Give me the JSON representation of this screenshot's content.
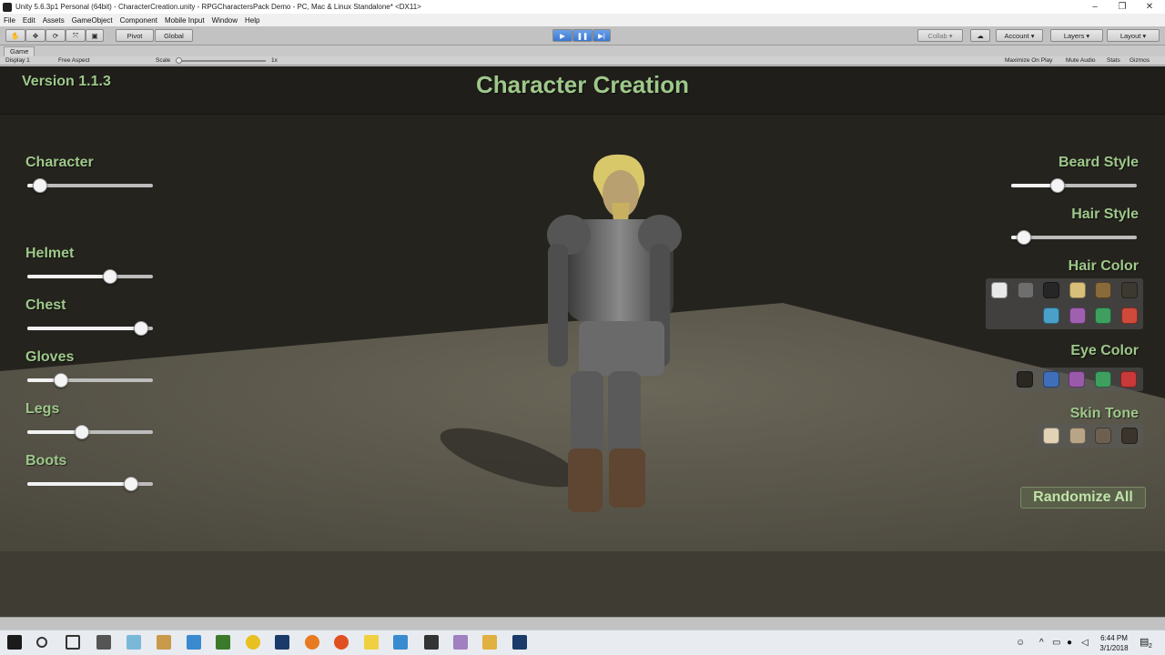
{
  "window": {
    "title": "Unity 5.6.3p1 Personal (64bit) - CharacterCreation.unity - RPGCharactersPack Demo - PC, Mac & Linux Standalone* <DX11>",
    "controls": [
      "–",
      "❐",
      "✕"
    ]
  },
  "menu": [
    "File",
    "Edit",
    "Assets",
    "GameObject",
    "Component",
    "Mobile Input",
    "Window",
    "Help"
  ],
  "toolbar": {
    "pivot": "Pivot",
    "global": "Global",
    "collab": "Collab ▾",
    "account": "Account ▾",
    "layers": "Layers ▾",
    "layout": "Layout ▾"
  },
  "game_view": {
    "tab": "Game",
    "display": "Display 1",
    "aspect": "Free Aspect",
    "scale_label": "Scale",
    "scale_value": "1x",
    "scale_fraction": 0.0,
    "options": [
      "Maximize On Play",
      "Mute Audio",
      "Stats",
      "Gizmos"
    ]
  },
  "game_ui": {
    "version": "Version 1.1.3",
    "title": "Character Creation",
    "sliders_left": [
      {
        "label": "Character",
        "value": 0.05
      },
      {
        "label": "Helmet",
        "value": 0.68
      },
      {
        "label": "Chest",
        "value": 0.96
      },
      {
        "label": "Gloves",
        "value": 0.24
      },
      {
        "label": "Legs",
        "value": 0.43
      },
      {
        "label": "Boots",
        "value": 0.87
      }
    ],
    "sliders_right": [
      {
        "label": "Beard Style",
        "value": 0.35
      },
      {
        "label": "Hair Style",
        "value": 0.05
      }
    ],
    "hair_color_label": "Hair Color",
    "hair_colors_row1": [
      "#e8e8e8",
      "#6e6e6e",
      "#262626",
      "#d8c07a",
      "#8a6a3a",
      "#3c3a30"
    ],
    "hair_colors_row2": [
      "#4aa0c8",
      "#a060b0",
      "#3f9f5f",
      "#cf4a3a"
    ],
    "eye_color_label": "Eye Color",
    "eye_colors": [
      "#2a2620",
      "#3f6fb8",
      "#9a5aaa",
      "#3f9f5f",
      "#c83a3a"
    ],
    "skin_tone_label": "Skin Tone",
    "skin_tones": [
      "#e2d2b6",
      "#b8a486",
      "#6e6050",
      "#3a342c"
    ],
    "randomize": "Randomize All"
  },
  "taskbar": {
    "time": "6:44 PM",
    "date": "3/1/2018",
    "notifications": "2"
  }
}
